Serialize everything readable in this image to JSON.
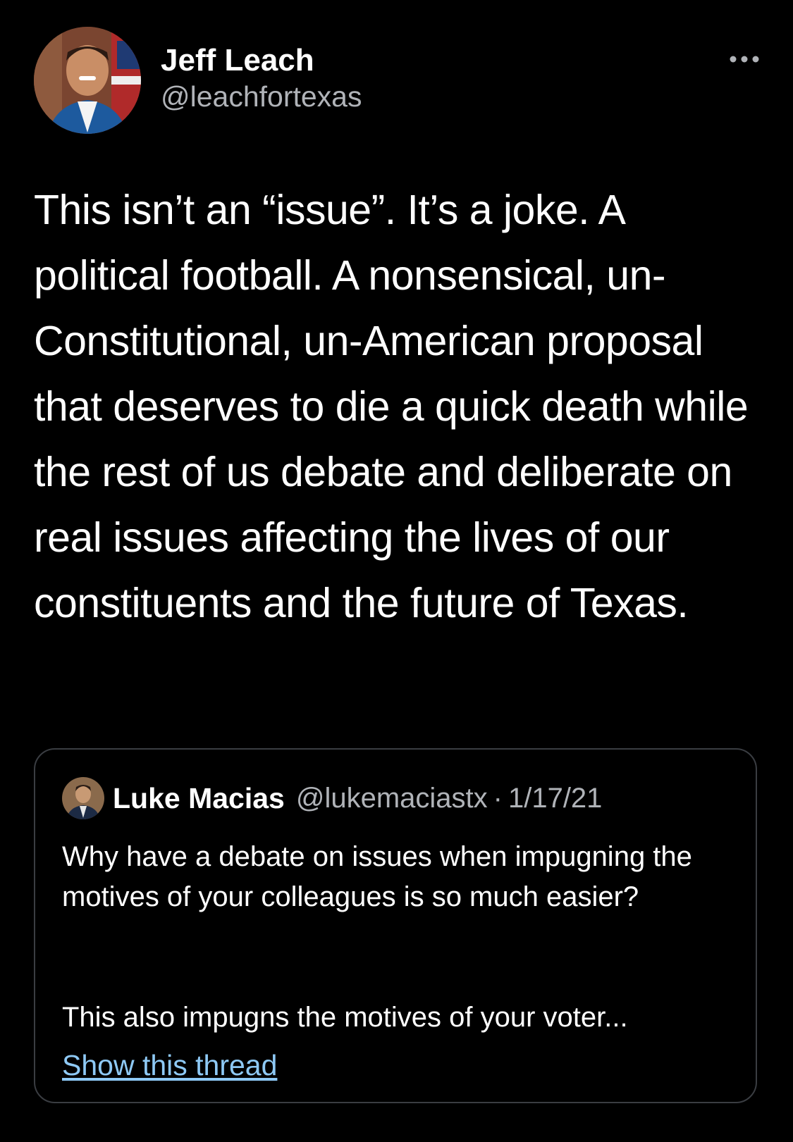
{
  "tweet": {
    "author": {
      "display_name": "Jeff Leach",
      "handle": "@leachfortexas"
    },
    "more_icon": "more-horizontal-icon",
    "text": "This isn’t an “issue”. It’s a joke. A political football. A nonsensical, un-Constitutional, un-American proposal that deserves to die a quick death while the rest of us debate and deliberate on real issues affecting the lives of our constituents and the future of Texas."
  },
  "quoted_tweet": {
    "author": {
      "display_name": "Luke Macias",
      "handle": "@lukemaciastx"
    },
    "separator": "·",
    "date": "1/17/21",
    "text": "Why have a debate on issues when impugning the motives of your colleagues is so much easier?",
    "text_continued": "This also impugns the motives of your voter...",
    "show_thread_label": "Show this thread"
  },
  "colors": {
    "background": "#000000",
    "text_primary": "#ffffff",
    "text_secondary": "#b0b3b8",
    "link": "#8ec9f5",
    "border": "#3a3d42"
  }
}
